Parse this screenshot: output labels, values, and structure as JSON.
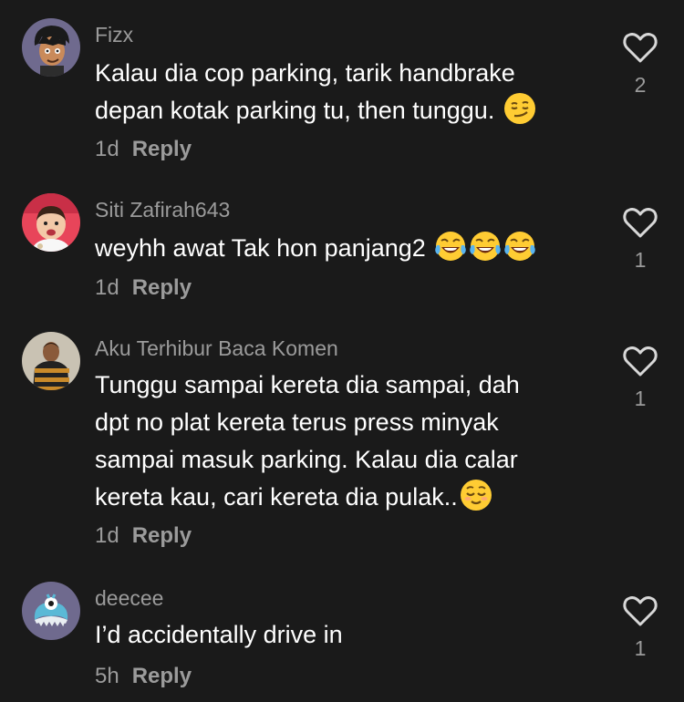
{
  "comments": [
    {
      "username": "Fizx",
      "lines": [
        "Kalau dia cop parking, tarik handbrake",
        "depan kotak parking tu, then tunggu."
      ],
      "emoji": "smirking-face-emoji",
      "time": "1d",
      "reply_label": "Reply",
      "likes": "2"
    },
    {
      "username": "Siti Zafirah643",
      "lines": [
        "weyhh awat Tak hon panjang2"
      ],
      "emoji": "tears-of-joy-emoji",
      "time": "1d",
      "reply_label": "Reply",
      "likes": "1"
    },
    {
      "username": "Aku Terhibur Baca Komen",
      "lines": [
        "Tunggu sampai kereta dia sampai, dah",
        "dpt no plat kereta terus press minyak",
        "sampai masuk parking. Kalau dia calar",
        "kereta kau, cari kereta dia pulak.."
      ],
      "emoji": "relieved-face-emoji",
      "time": "1d",
      "reply_label": "Reply",
      "likes": "1"
    },
    {
      "username": "deecee",
      "lines": [
        "I’d accidentally drive in"
      ],
      "emoji": "",
      "time": "5h",
      "reply_label": "Reply",
      "likes": "1"
    }
  ],
  "icons": {
    "like": "heart-outline-icon"
  },
  "colors": {
    "background": "#1a1a1a",
    "username": "#9b9b9b",
    "text": "#ffffff",
    "meta": "#9b9b9b"
  }
}
